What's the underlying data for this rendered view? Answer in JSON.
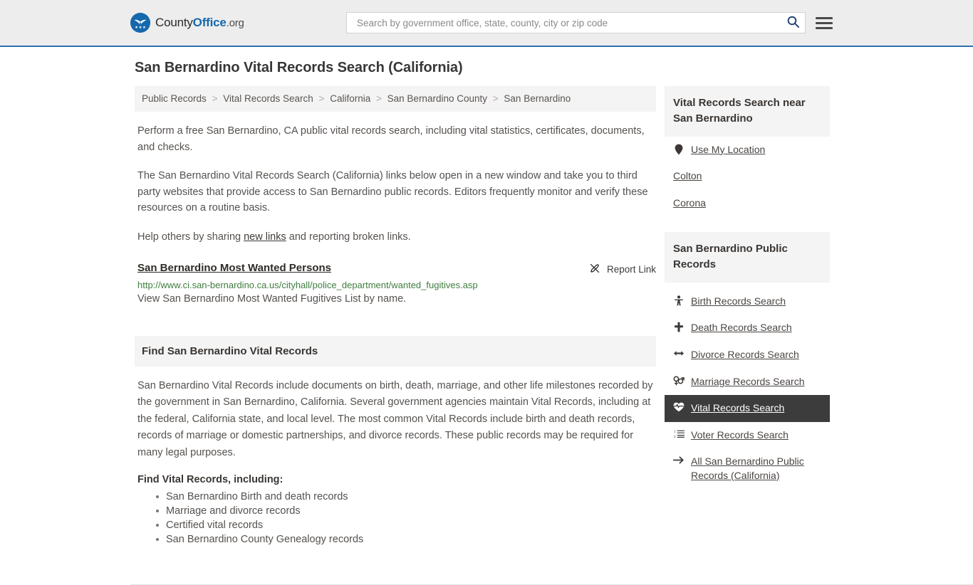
{
  "header": {
    "brand": {
      "part1": "County",
      "part2": "Office",
      "part3": ".org",
      "logo_icon": "eagle-stars-icon"
    },
    "search": {
      "placeholder": "Search by government office, state, county, city or zip code",
      "value": "",
      "button_icon": "search-icon"
    },
    "menu_icon": "hamburger-menu-icon"
  },
  "page": {
    "title": "San Bernardino Vital Records Search (California)"
  },
  "breadcrumb": {
    "separator": ">",
    "items": [
      {
        "label": "Public Records"
      },
      {
        "label": "Vital Records Search"
      },
      {
        "label": "California"
      },
      {
        "label": "San Bernardino County"
      },
      {
        "label": "San Bernardino"
      }
    ]
  },
  "intro": {
    "p1": "Perform a free San Bernardino, CA public vital records search, including vital statistics, certificates, documents, and checks.",
    "p2": "The San Bernardino Vital Records Search (California) links below open in a new window and take you to third party websites that provide access to San Bernardino public records. Editors frequently monitor and verify these resources on a routine basis.",
    "p3_before": "Help others by sharing ",
    "p3_link": "new links",
    "p3_after": " and reporting broken links."
  },
  "result": {
    "title": "San Bernardino Most Wanted Persons",
    "url": "http://www.ci.san-bernardino.ca.us/cityhall/police_department/wanted_fugitives.asp",
    "description": "View San Bernardino Most Wanted Fugitives List by name.",
    "report_label": "Report Link",
    "report_icon": "broken-link-icon"
  },
  "section": {
    "heading": "Find San Bernardino Vital Records",
    "paragraph": "San Bernardino Vital Records include documents on birth, death, marriage, and other life milestones recorded by the government in San Bernardino, California. Several government agencies maintain Vital Records, including at the federal, California state, and local level. The most common Vital Records include birth and death records, records of marriage or domestic partnerships, and divorce records. These public records may be required for many legal purposes.",
    "sub_heading": "Find Vital Records, including:",
    "bullets": [
      "San Bernardino Birth and death records",
      "Marriage and divorce records",
      "Certified vital records",
      "San Bernardino County Genealogy records"
    ]
  },
  "sidebar": {
    "near": {
      "heading": "Vital Records Search near San Bernardino",
      "items": [
        {
          "label": "Use My Location",
          "icon": "map-pin-icon",
          "has_icon": true
        },
        {
          "label": "Colton",
          "icon": "",
          "has_icon": false
        },
        {
          "label": "Corona",
          "icon": "",
          "has_icon": false
        }
      ]
    },
    "public_records": {
      "heading": "San Bernardino Public Records",
      "items": [
        {
          "label": "Birth Records Search",
          "icon": "baby-icon",
          "active": false
        },
        {
          "label": "Death Records Search",
          "icon": "cross-icon",
          "active": false
        },
        {
          "label": "Divorce Records Search",
          "icon": "arrows-left-right-icon",
          "active": false
        },
        {
          "label": "Marriage Records Search",
          "icon": "venus-mars-icon",
          "active": false
        },
        {
          "label": "Vital Records Search",
          "icon": "heart-pulse-icon",
          "active": true
        },
        {
          "label": "Voter Records Search",
          "icon": "ordered-list-icon",
          "active": false
        },
        {
          "label": "All San Bernardino Public Records (California)",
          "icon": "arrow-right-icon",
          "active": false
        }
      ]
    }
  },
  "colors": {
    "brand_blue": "#1668ad",
    "header_bg": "#ededed",
    "header_border": "#2c6fad",
    "panel_bg": "#f4f4f4",
    "active_bg": "#3c3c3c",
    "url_green": "#3f7d3f",
    "body_text": "#55514e"
  }
}
